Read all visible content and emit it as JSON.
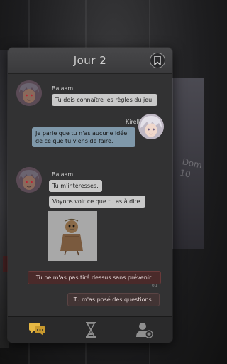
{
  "header": {
    "title": "Jour 2"
  },
  "messages": {
    "m1": {
      "speaker": "Balaam",
      "text": "Tu dois connaître les règles du jeu."
    },
    "m2": {
      "speaker": "Kirell",
      "text": "Je parie que tu n'as aucune idée de ce que tu viens de faire."
    },
    "m3": {
      "speaker": "Balaam",
      "text1": "Tu m'intéresses.",
      "text2": "Voyons voir ce que tu as à dire."
    }
  },
  "choices": {
    "option1": "Tu ne m'as pas tiré dessus sans prévenir.",
    "or_label": "ou",
    "option2": "Tu m'as posé des questions."
  },
  "background": {
    "sign_text": "Dom 10"
  },
  "icons": {
    "bookmark": "bookmark-icon",
    "chat": "chat-bubbles-icon",
    "hourglass": "hourglass-icon",
    "add_contact": "add-contact-icon"
  },
  "colors": {
    "accent": "#e6b844",
    "panel": "#323233",
    "choice_bg": "#4a2a2a"
  }
}
